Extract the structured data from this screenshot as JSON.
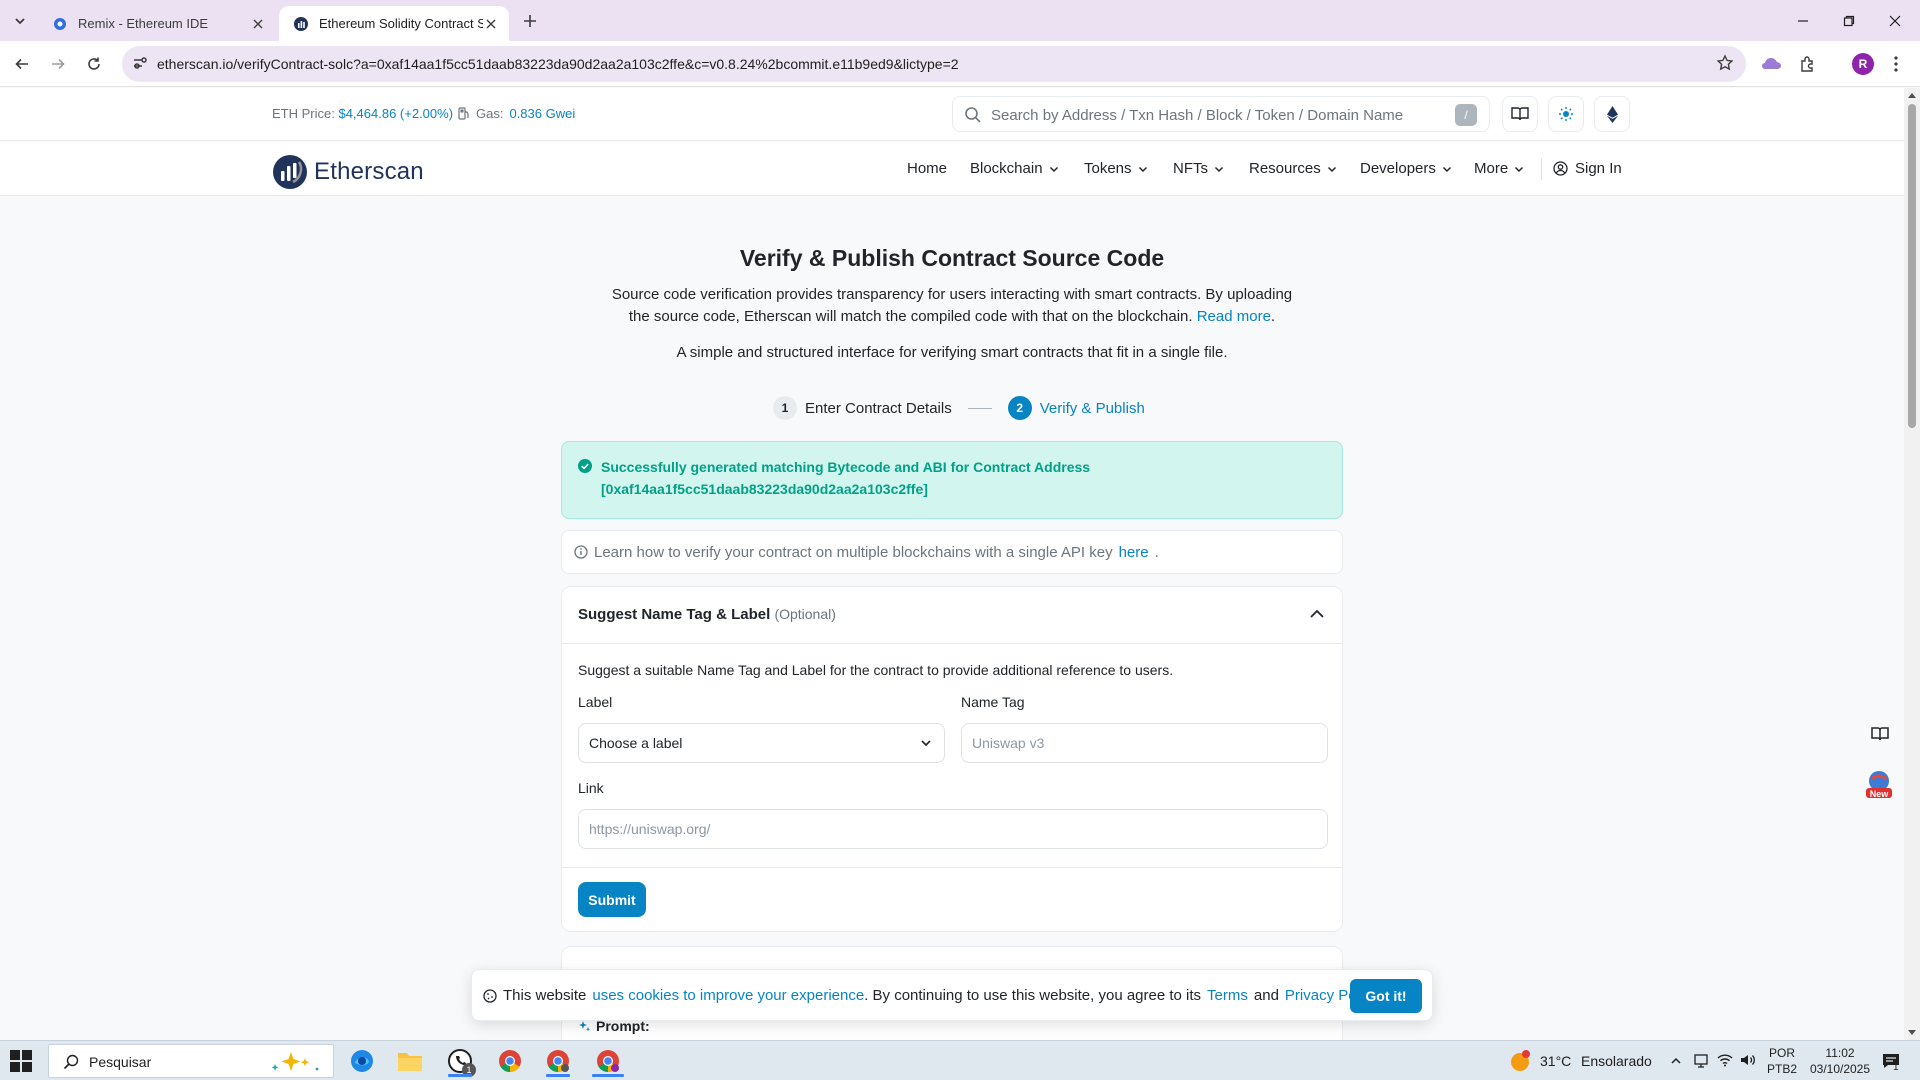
{
  "browser": {
    "tabs": [
      {
        "title": "Remix - Ethereum IDE"
      },
      {
        "title": "Ethereum Solidity Contract Sou"
      }
    ],
    "url": "etherscan.io/verifyContract-solc?a=0xaf14aa1f5cc51daab83223da90d2aa2a103c2ffe&c=v0.8.24%2bcommit.e11b9ed9&lictype=2",
    "profile_initial": "R"
  },
  "topbar": {
    "eth_price_label": "ETH Price:",
    "eth_price_value": "$4,464.86 (+2.00%)",
    "gas_label": "Gas:",
    "gas_value": "0.836 Gwei",
    "search_placeholder": "Search by Address / Txn Hash / Block / Token / Domain Name",
    "search_shortcut": "/"
  },
  "header": {
    "logo_text": "Etherscan",
    "nav": [
      "Home",
      "Blockchain",
      "Tokens",
      "NFTs",
      "Resources",
      "Developers",
      "More"
    ],
    "sign_in": "Sign In"
  },
  "main": {
    "title": "Verify & Publish Contract Source Code",
    "intro": "Source code verification provides transparency for users interacting with smart contracts. By uploading the source code, Etherscan will match the compiled code with that on the blockchain.",
    "read_more": "Read more",
    "subtitle": "A simple and structured interface for verifying smart contracts that fit in a single file.",
    "steps": [
      {
        "num": "1",
        "label": "Enter Contract Details"
      },
      {
        "num": "2",
        "label": "Verify & Publish"
      }
    ],
    "success_line1": "Successfully generated matching Bytecode and ABI for Contract Address",
    "success_line2": "[0xaf14aa1f5cc51daab83223da90d2aa2a103c2ffe]",
    "info_text": "Learn how to verify your contract on multiple blockchains with a single API key",
    "info_link": "here"
  },
  "suggest_card": {
    "title": "Suggest Name Tag & Label",
    "optional": "(Optional)",
    "description": "Suggest a suitable Name Tag and Label for the contract to provide additional reference to users.",
    "label_field_label": "Label",
    "label_select_value": "Choose a label",
    "name_tag_label": "Name Tag",
    "name_tag_placeholder": "Uniswap v3",
    "link_label": "Link",
    "link_placeholder": "https://uniswap.org/",
    "submit": "Submit"
  },
  "next_card": {
    "prompt": "Prompt:"
  },
  "cookie": {
    "text1": "This website",
    "link1": "uses cookies to improve your experience",
    "text2": ". By continuing to use this website, you agree to its",
    "terms": "Terms",
    "and": "and",
    "privacy": "Privacy Policy",
    "button": "Got it!"
  },
  "side": {
    "new_badge": "New"
  },
  "taskbar": {
    "search_placeholder": "Pesquisar",
    "whatsapp_badge": "1",
    "weather_temp": "31°C",
    "weather_desc": "Ensolarado",
    "lang1": "POR",
    "lang2": "PTB2",
    "time": "11:02",
    "date": "03/10/2025",
    "notif_count": "1"
  },
  "colors": {
    "brand": "#0784c3",
    "success_bg": "#d3f5ef",
    "success_text": "#00a186",
    "logo_navy": "#21325b"
  }
}
